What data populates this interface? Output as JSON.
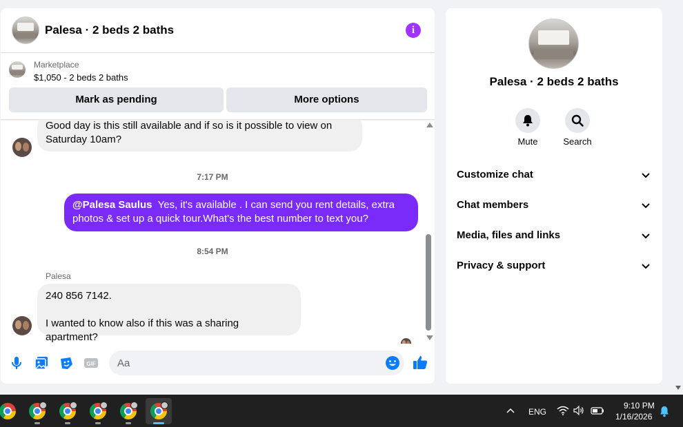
{
  "chat": {
    "title": "Palesa · 2 beds 2 baths",
    "marketplace_label": "Marketplace",
    "listing": "$1,050 - 2 beds 2 baths",
    "mark_pending": "Mark as pending",
    "more_options": "More options"
  },
  "messages": {
    "incoming_1_line1": "Good day is this still available and if so is it possible to view on",
    "incoming_1_line2": "Saturday 10am?",
    "time_1": "7:17 PM",
    "outgoing_mention": "@Palesa Saulus",
    "outgoing_text": "Yes, it's available .  I can send you rent details, extra photos & set up a quick tour.What's the best number to text you?",
    "time_2": "8:54 PM",
    "sender_name": "Palesa",
    "incoming_2_line1": "240 856 7142.",
    "incoming_2_line2": "I wanted to know also if this was a sharing apartment?"
  },
  "composer": {
    "placeholder": "Aa"
  },
  "side": {
    "title": "Palesa · 2 beds 2 baths",
    "mute": "Mute",
    "search": "Search",
    "sections": [
      "Customize chat",
      "Chat members",
      "Media, files and links",
      "Privacy & support"
    ]
  },
  "taskbar": {
    "lang": "ENG",
    "time": "9:10 PM",
    "date": "1/16/2026"
  },
  "colors": {
    "accent": "#7b2bf9",
    "info": "#a033ff",
    "messenger_blue": "#0a7cff"
  }
}
